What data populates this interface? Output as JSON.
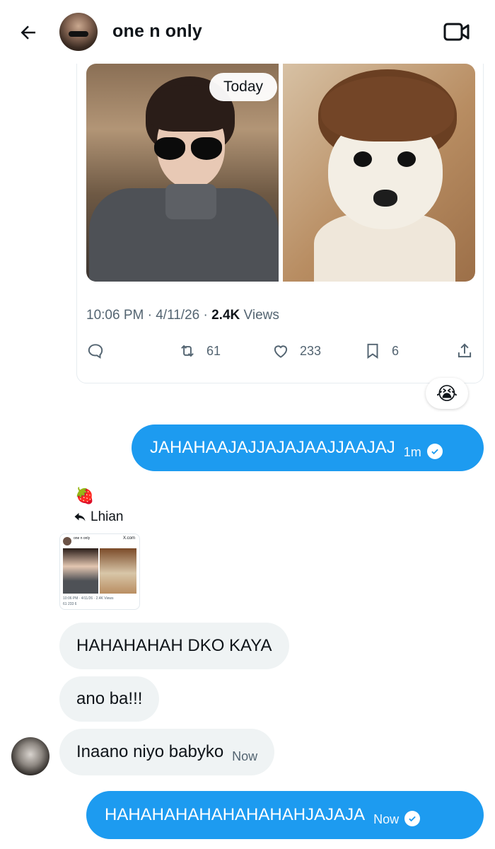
{
  "header": {
    "back_icon": "arrow-left-icon",
    "name": "one n only",
    "video_icon": "video-camera-icon"
  },
  "tweet": {
    "date_pill": "Today",
    "time": "10:06 PM",
    "date": "4/11/26",
    "views_count": "2.4K",
    "views_label": "Views",
    "retweets": "61",
    "likes": "233",
    "bookmarks": "6"
  },
  "reaction": {
    "emoji": "😭"
  },
  "messages": [
    {
      "direction": "out",
      "text": "JAHAHAAJAJJAJAJAAJJAAJAJ",
      "time": "1m"
    },
    {
      "direction": "in",
      "text": "HAHAHAHAH DKO KAYA"
    },
    {
      "direction": "in",
      "text": "ano ba!!!"
    },
    {
      "direction": "in",
      "text": "Inaano niyo babyko",
      "time": "Now"
    },
    {
      "direction": "out",
      "text": "HAHAHAHAHAHAHAHAHJAJAJA",
      "time": "Now"
    }
  ],
  "reply_context": {
    "emoji": "🍓",
    "reply_to": "Lhian"
  },
  "thumbnail": {
    "site": "X.com",
    "meta": "10:06 PM · 4/11/26 · 2.4K Views",
    "actions": "61   233   6"
  },
  "colors": {
    "accent_blue": "#1d9bf0",
    "incoming_bubble": "#eff3f4",
    "secondary_text": "#536471"
  }
}
